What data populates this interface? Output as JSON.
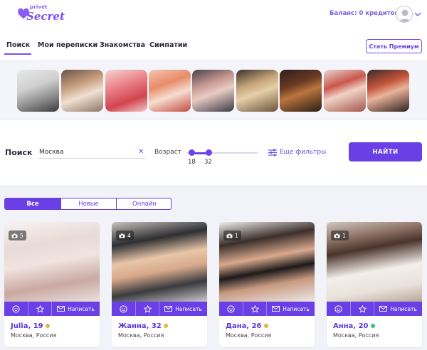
{
  "header": {
    "logo_top": "privet",
    "logo_main": "Secret",
    "balance": "Баланс: 0 кредитов"
  },
  "nav": {
    "items": [
      "Поиск",
      "Мои переписки",
      "Знакомства",
      "Симпатии"
    ],
    "active": 0,
    "premium_label": "Стать Премиум"
  },
  "search": {
    "title": "Поиск",
    "city_value": "Москва",
    "clear_icon": "close-icon",
    "age_label": "Возраст",
    "age_min": "18",
    "age_max": "32",
    "filters_label": "Еще фильтры",
    "find_label": "НАЙТИ"
  },
  "segment": {
    "items": [
      "Все",
      "Новые",
      "Онлайн"
    ],
    "active": 0
  },
  "cards": [
    {
      "name": "Julia, 19",
      "status_color": "#e9b23c",
      "location": "Москва, Россия",
      "photo_count": "5",
      "write_label": "Написать"
    },
    {
      "name": "Жанна, 32",
      "status_color": "#e9b23c",
      "location": "Москва, Россия",
      "photo_count": "4",
      "write_label": "Написать"
    },
    {
      "name": "Дана, 26",
      "status_color": "#e9b23c",
      "location": "Москва, Россия",
      "photo_count": "1",
      "write_label": "Написать"
    },
    {
      "name": "Анна, 20",
      "status_color": "#3cc36a",
      "location": "Москва, Россия",
      "photo_count": "1",
      "write_label": "Написать"
    }
  ],
  "colors": {
    "accent": "#6a3fe6",
    "online": "#3cc36a",
    "away": "#e9b23c"
  }
}
